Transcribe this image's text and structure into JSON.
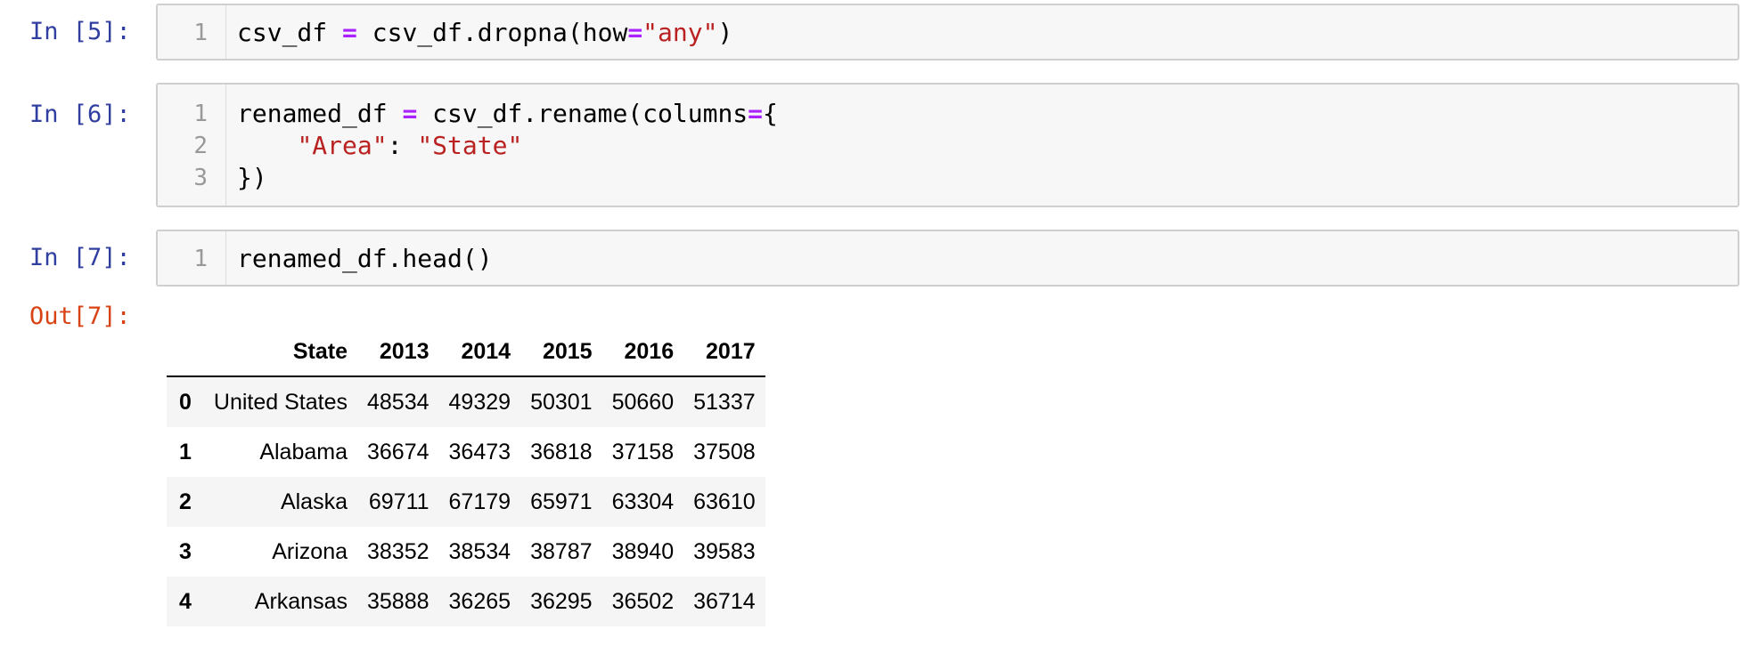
{
  "cells": [
    {
      "prompt": "In [5]:",
      "lines": [
        {
          "no": "1",
          "tokens": [
            {
              "t": "csv_df ",
              "c": ""
            },
            {
              "t": "=",
              "c": "op"
            },
            {
              "t": " csv_df.dropna(how",
              "c": ""
            },
            {
              "t": "=",
              "c": "op"
            },
            {
              "t": "\"any\"",
              "c": "str"
            },
            {
              "t": ")",
              "c": ""
            }
          ]
        }
      ]
    },
    {
      "prompt": "In [6]:",
      "lines": [
        {
          "no": "1",
          "tokens": [
            {
              "t": "renamed_df ",
              "c": ""
            },
            {
              "t": "=",
              "c": "op"
            },
            {
              "t": " csv_df.rename(columns",
              "c": ""
            },
            {
              "t": "=",
              "c": "op"
            },
            {
              "t": "{",
              "c": ""
            }
          ]
        },
        {
          "no": "2",
          "tokens": [
            {
              "t": "    ",
              "c": ""
            },
            {
              "t": "\"Area\"",
              "c": "str"
            },
            {
              "t": ": ",
              "c": ""
            },
            {
              "t": "\"State\"",
              "c": "str"
            }
          ]
        },
        {
          "no": "3",
          "tokens": [
            {
              "t": "})",
              "c": ""
            }
          ]
        }
      ]
    },
    {
      "prompt": "In [7]:",
      "lines": [
        {
          "no": "1",
          "tokens": [
            {
              "t": "renamed_df.head()",
              "c": ""
            }
          ]
        }
      ]
    }
  ],
  "output": {
    "prompt": "Out[7]:",
    "table": {
      "index_header": "",
      "columns": [
        "State",
        "2013",
        "2014",
        "2015",
        "2016",
        "2017"
      ],
      "rows": [
        {
          "index": "0",
          "values": [
            "United States",
            "48534",
            "49329",
            "50301",
            "50660",
            "51337"
          ]
        },
        {
          "index": "1",
          "values": [
            "Alabama",
            "36674",
            "36473",
            "36818",
            "37158",
            "37508"
          ]
        },
        {
          "index": "2",
          "values": [
            "Alaska",
            "69711",
            "67179",
            "65971",
            "63304",
            "63610"
          ]
        },
        {
          "index": "3",
          "values": [
            "Arizona",
            "38352",
            "38534",
            "38787",
            "38940",
            "39583"
          ]
        },
        {
          "index": "4",
          "values": [
            "Arkansas",
            "35888",
            "36265",
            "36295",
            "36502",
            "36714"
          ]
        }
      ]
    }
  },
  "colors": {
    "in_prompt": "#303f9f",
    "out_prompt": "#d84315",
    "operator": "#aa22ff",
    "string": "#ba2121",
    "cell_bg": "#f7f7f7"
  }
}
